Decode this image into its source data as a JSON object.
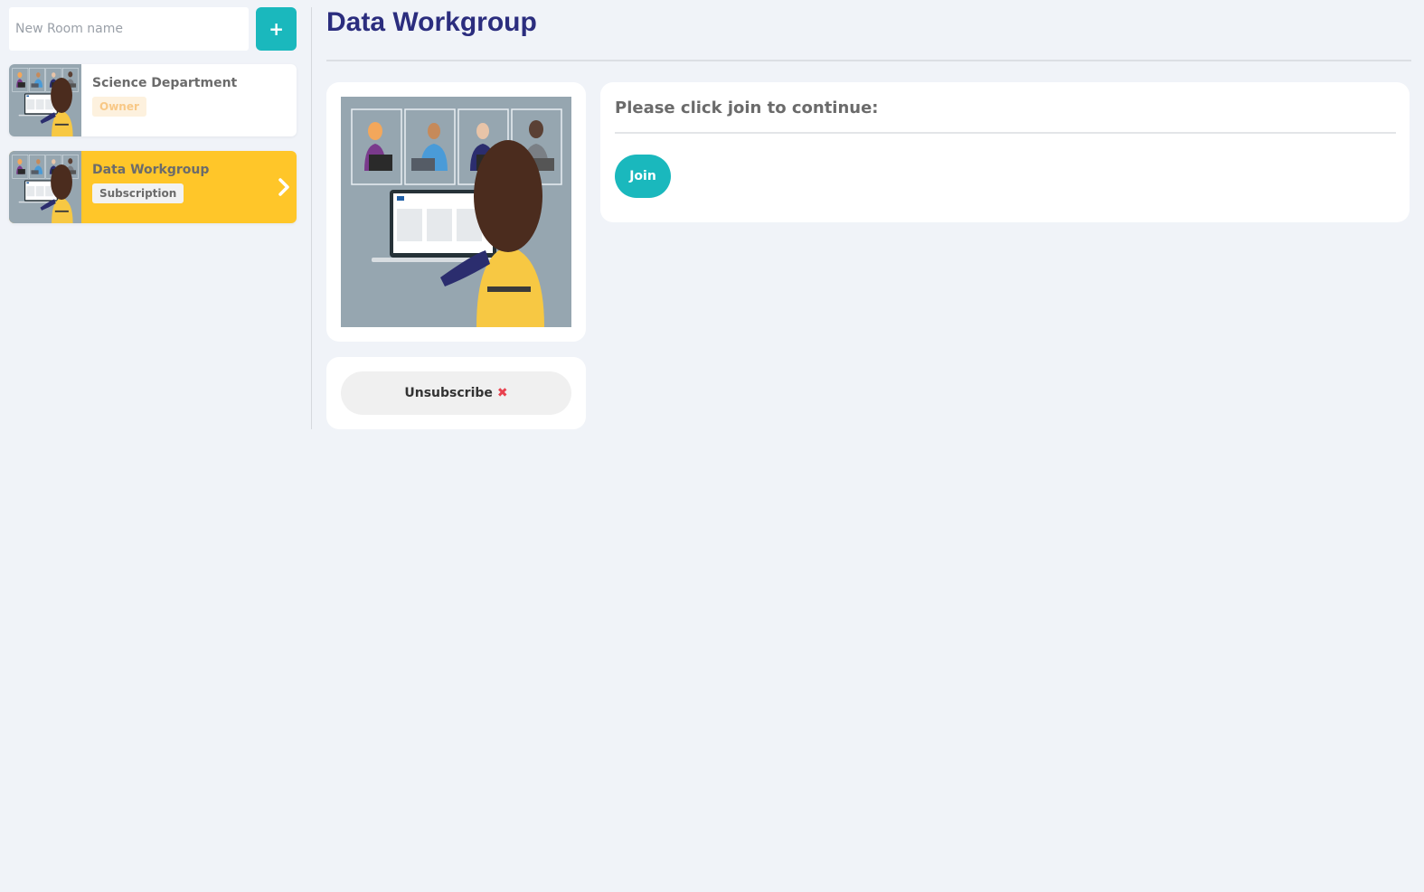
{
  "sidebar": {
    "new_room_placeholder": "New Room name",
    "add_button_label": "+",
    "rooms": [
      {
        "name": "Science Department",
        "badge": "Owner",
        "active": false
      },
      {
        "name": "Data Workgroup",
        "badge": "Subscription",
        "active": true
      }
    ]
  },
  "main": {
    "title": "Data Workgroup",
    "join_prompt": "Please click join to continue:",
    "join_label": "Join",
    "unsubscribe_label": "Unsubscribe",
    "unsubscribe_icon": "✖"
  },
  "colors": {
    "accent_teal": "#1ab8bd",
    "active_yellow": "#ffc629",
    "title_navy": "#2b2d7e",
    "danger_red": "#e8424f"
  }
}
